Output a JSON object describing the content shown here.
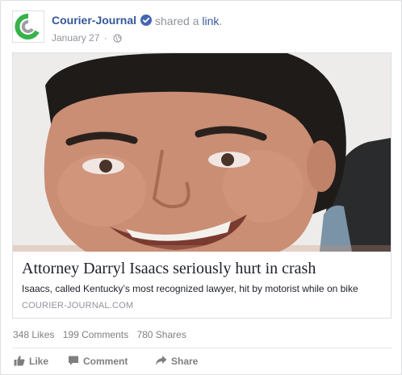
{
  "post": {
    "page_name": "Courier-Journal",
    "shared_prefix": "shared a",
    "shared_link": "link",
    "shared_suffix": ".",
    "date": "January 27",
    "separator": "·"
  },
  "attachment": {
    "headline": "Attorney Darryl Isaacs seriously hurt in crash",
    "description": "Isaacs, called Kentucky’s most recognized lawyer, hit by motorist while on bike",
    "domain": "COURIER-JOURNAL.COM"
  },
  "stats": {
    "likes": "348 Likes",
    "comments": "199 Comments",
    "shares": "780 Shares"
  },
  "actions": {
    "like": "Like",
    "comment": "Comment",
    "share": "Share"
  },
  "colors": {
    "link_blue": "#365899",
    "meta_grey": "#90949c",
    "logo_green": "#37b34a",
    "verified_blue": "#4267b2"
  },
  "icons": {
    "avatar": "courier-journal-logo",
    "verified": "verified-badge-icon",
    "audience": "globe-icon",
    "like": "thumbs-up-icon",
    "comment": "speech-bubble-icon",
    "share": "share-arrow-icon"
  }
}
